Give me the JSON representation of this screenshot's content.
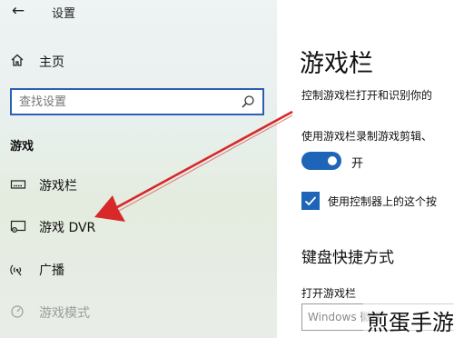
{
  "window": {
    "app_title": "设置"
  },
  "sidebar": {
    "home_label": "主页",
    "search_placeholder": "查找设置",
    "section_title": "游戏",
    "items": [
      {
        "label": "游戏栏",
        "icon": "game-bar-icon",
        "active": false,
        "dim": false
      },
      {
        "label": "游戏 DVR",
        "icon": "game-dvr-icon",
        "active": false,
        "dim": false
      },
      {
        "label": "广播",
        "icon": "broadcast-icon",
        "active": false,
        "dim": false
      },
      {
        "label": "游戏模式",
        "icon": "game-mode-icon",
        "active": false,
        "dim": true
      }
    ]
  },
  "main": {
    "page_title": "游戏栏",
    "description": "控制游戏栏打开和识别你的",
    "record_setting_label": "使用游戏栏录制游戏剪辑、",
    "toggle_state_text": "开",
    "toggle_on": true,
    "controller_checkbox_label": "使用控制器上的这个按",
    "controller_checkbox_checked": true,
    "shortcuts_section_title": "键盘快捷方式",
    "open_game_bar_label": "打开游戏栏",
    "open_game_bar_placeholder": "Windows 徽标"
  },
  "overlay": {
    "watermark_text": "煎蛋手游",
    "annotation_arrow_color": "#d7282a"
  },
  "colors": {
    "accent": "#1e64b7",
    "search_border": "#2b5fb4"
  }
}
